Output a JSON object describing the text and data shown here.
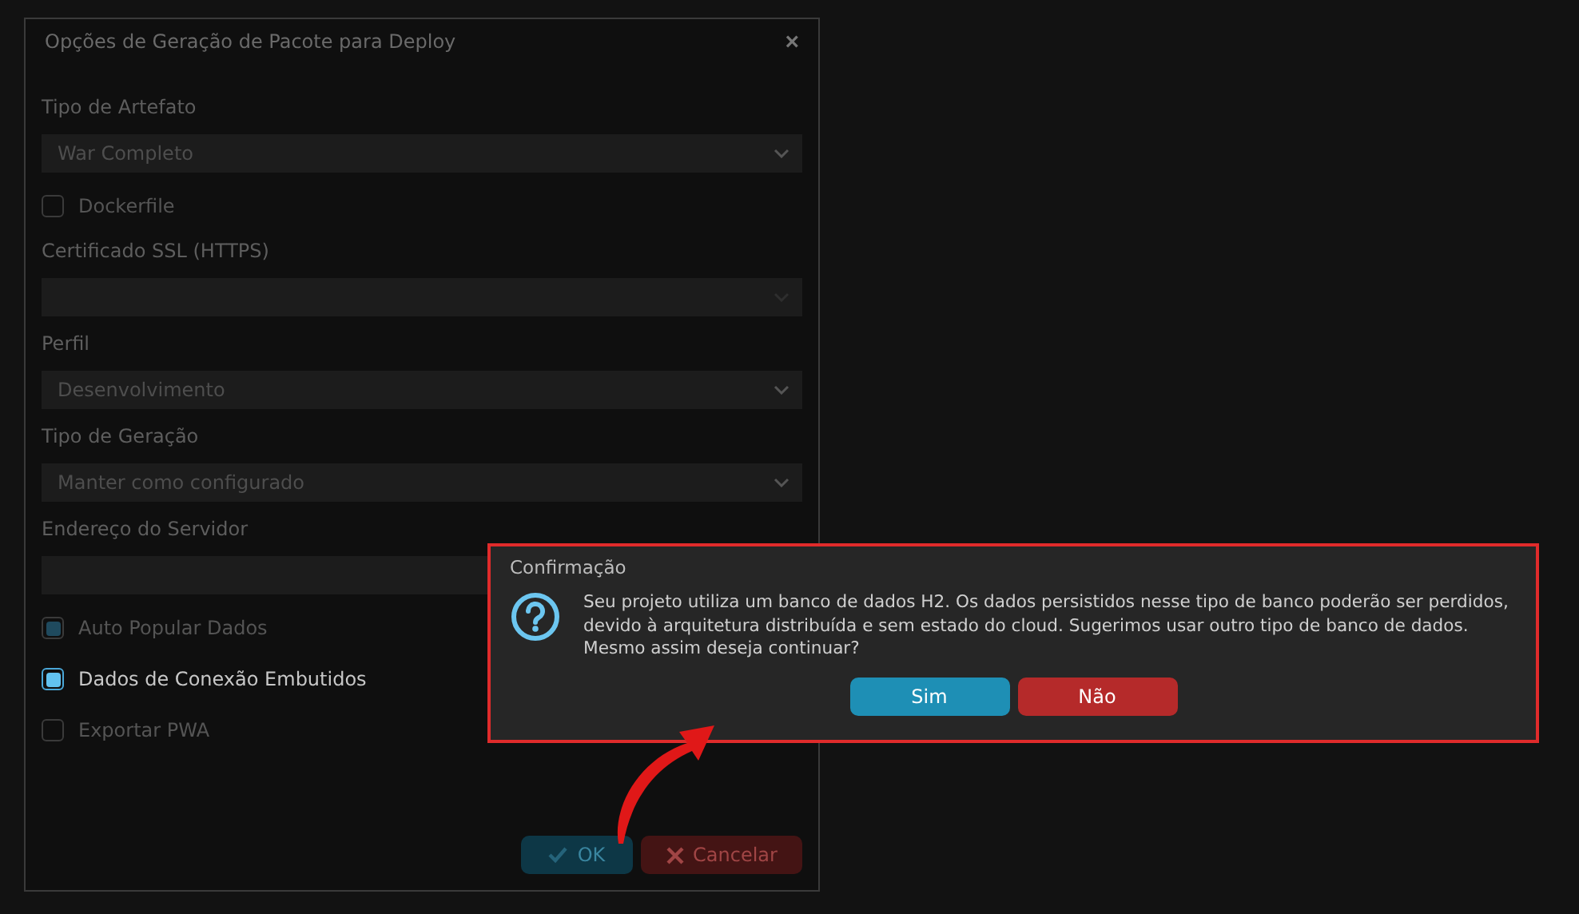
{
  "dialog": {
    "title": "Opções de Geração de Pacote para Deploy",
    "close": "×",
    "fields": [
      {
        "kind": "select",
        "label": "Tipo de Artefato",
        "value": "War Completo"
      },
      {
        "kind": "checkbox",
        "label": "Dockerfile",
        "checked": false,
        "focused": false
      },
      {
        "kind": "select",
        "label": "Certificado SSL (HTTPS)"
      },
      {
        "kind": "select",
        "label": "Perfil",
        "value": "Desenvolvimento"
      },
      {
        "kind": "select",
        "label": "Tipo de Geração",
        "value": "Manter como configurado"
      },
      {
        "kind": "text",
        "label": "Endereço do Servidor"
      },
      {
        "kind": "checkbox",
        "label": "Auto Popular Dados",
        "checked": true,
        "focused": false
      },
      {
        "kind": "checkbox",
        "label": "Dados de Conexão Embutidos",
        "checked": true,
        "focused": true
      },
      {
        "kind": "checkbox",
        "label": "Exportar PWA",
        "checked": false,
        "focused": false
      }
    ],
    "buttons": [
      {
        "kind": "ok",
        "label": "OK"
      },
      {
        "kind": "cancel",
        "label": "Cancelar"
      }
    ]
  },
  "confirm": {
    "title": "Confirmação",
    "message": "Seu projeto utiliza um banco de dados H2. Os dados persistidos nesse tipo de banco poderão ser perdidos, devido à arquitetura distribuída e sem estado do cloud. Sugerimos usar outro tipo de banco de dados. Mesmo assim deseja continuar?",
    "buttons": [
      {
        "kind": "yes",
        "label": "Sim"
      },
      {
        "kind": "no",
        "label": "Não"
      }
    ]
  }
}
